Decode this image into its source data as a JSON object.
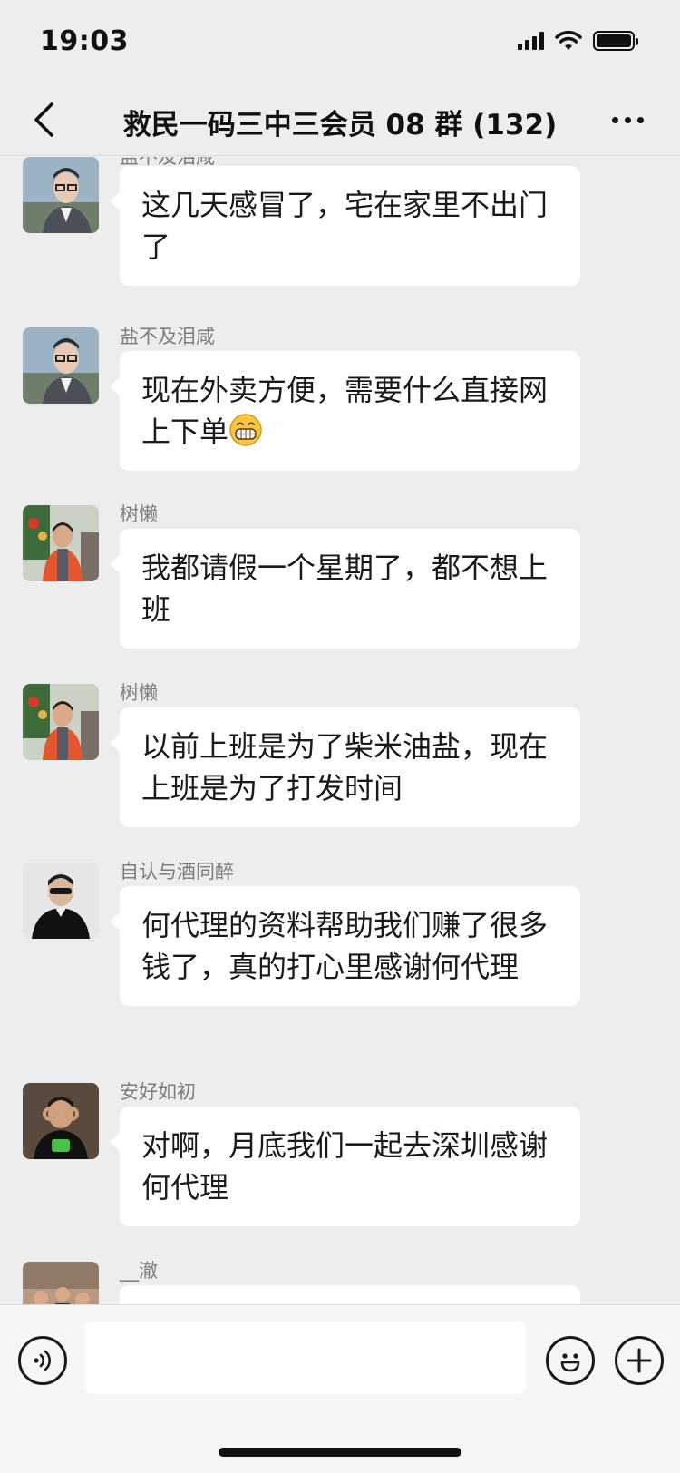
{
  "status_bar": {
    "time": "19:03"
  },
  "header": {
    "title": "救民一码三中三会员 08 群 (132)"
  },
  "messages": [
    {
      "sender": "盐不及泪咸",
      "text": "这几天感冒了，宅在家里不出门了",
      "avatar": "man-glasses-avatar"
    },
    {
      "sender": "盐不及泪咸",
      "text": "现在外卖方便，需要什么直接网上下单",
      "emoji": "grinning-face-emoji",
      "avatar": "man-glasses-avatar"
    },
    {
      "sender": "树懒",
      "text": "我都请假一个星期了，都不想上班",
      "avatar": "woman-orange-jacket-avatar"
    },
    {
      "sender": "树懒",
      "text": "以前上班是为了柴米油盐，现在上班是为了打发时间",
      "avatar": "woman-orange-jacket-avatar"
    },
    {
      "sender": "自认与酒同醉",
      "text": "何代理的资料帮助我们赚了很多钱了，真的打心里感谢何代理",
      "avatar": "person-black-shirt-avatar"
    },
    {
      "sender": "安好如初",
      "text": "对啊，月底我们一起去深圳感谢何代理",
      "avatar": "person-green-shirt-avatar"
    },
    {
      "sender": "__澈",
      "text": "",
      "avatar": "people-outdoor-avatar"
    }
  ],
  "input_bar": {
    "voice_icon": "voice-icon",
    "emoji_icon": "smiley-icon",
    "plus_icon": "plus-icon",
    "input_value": ""
  }
}
